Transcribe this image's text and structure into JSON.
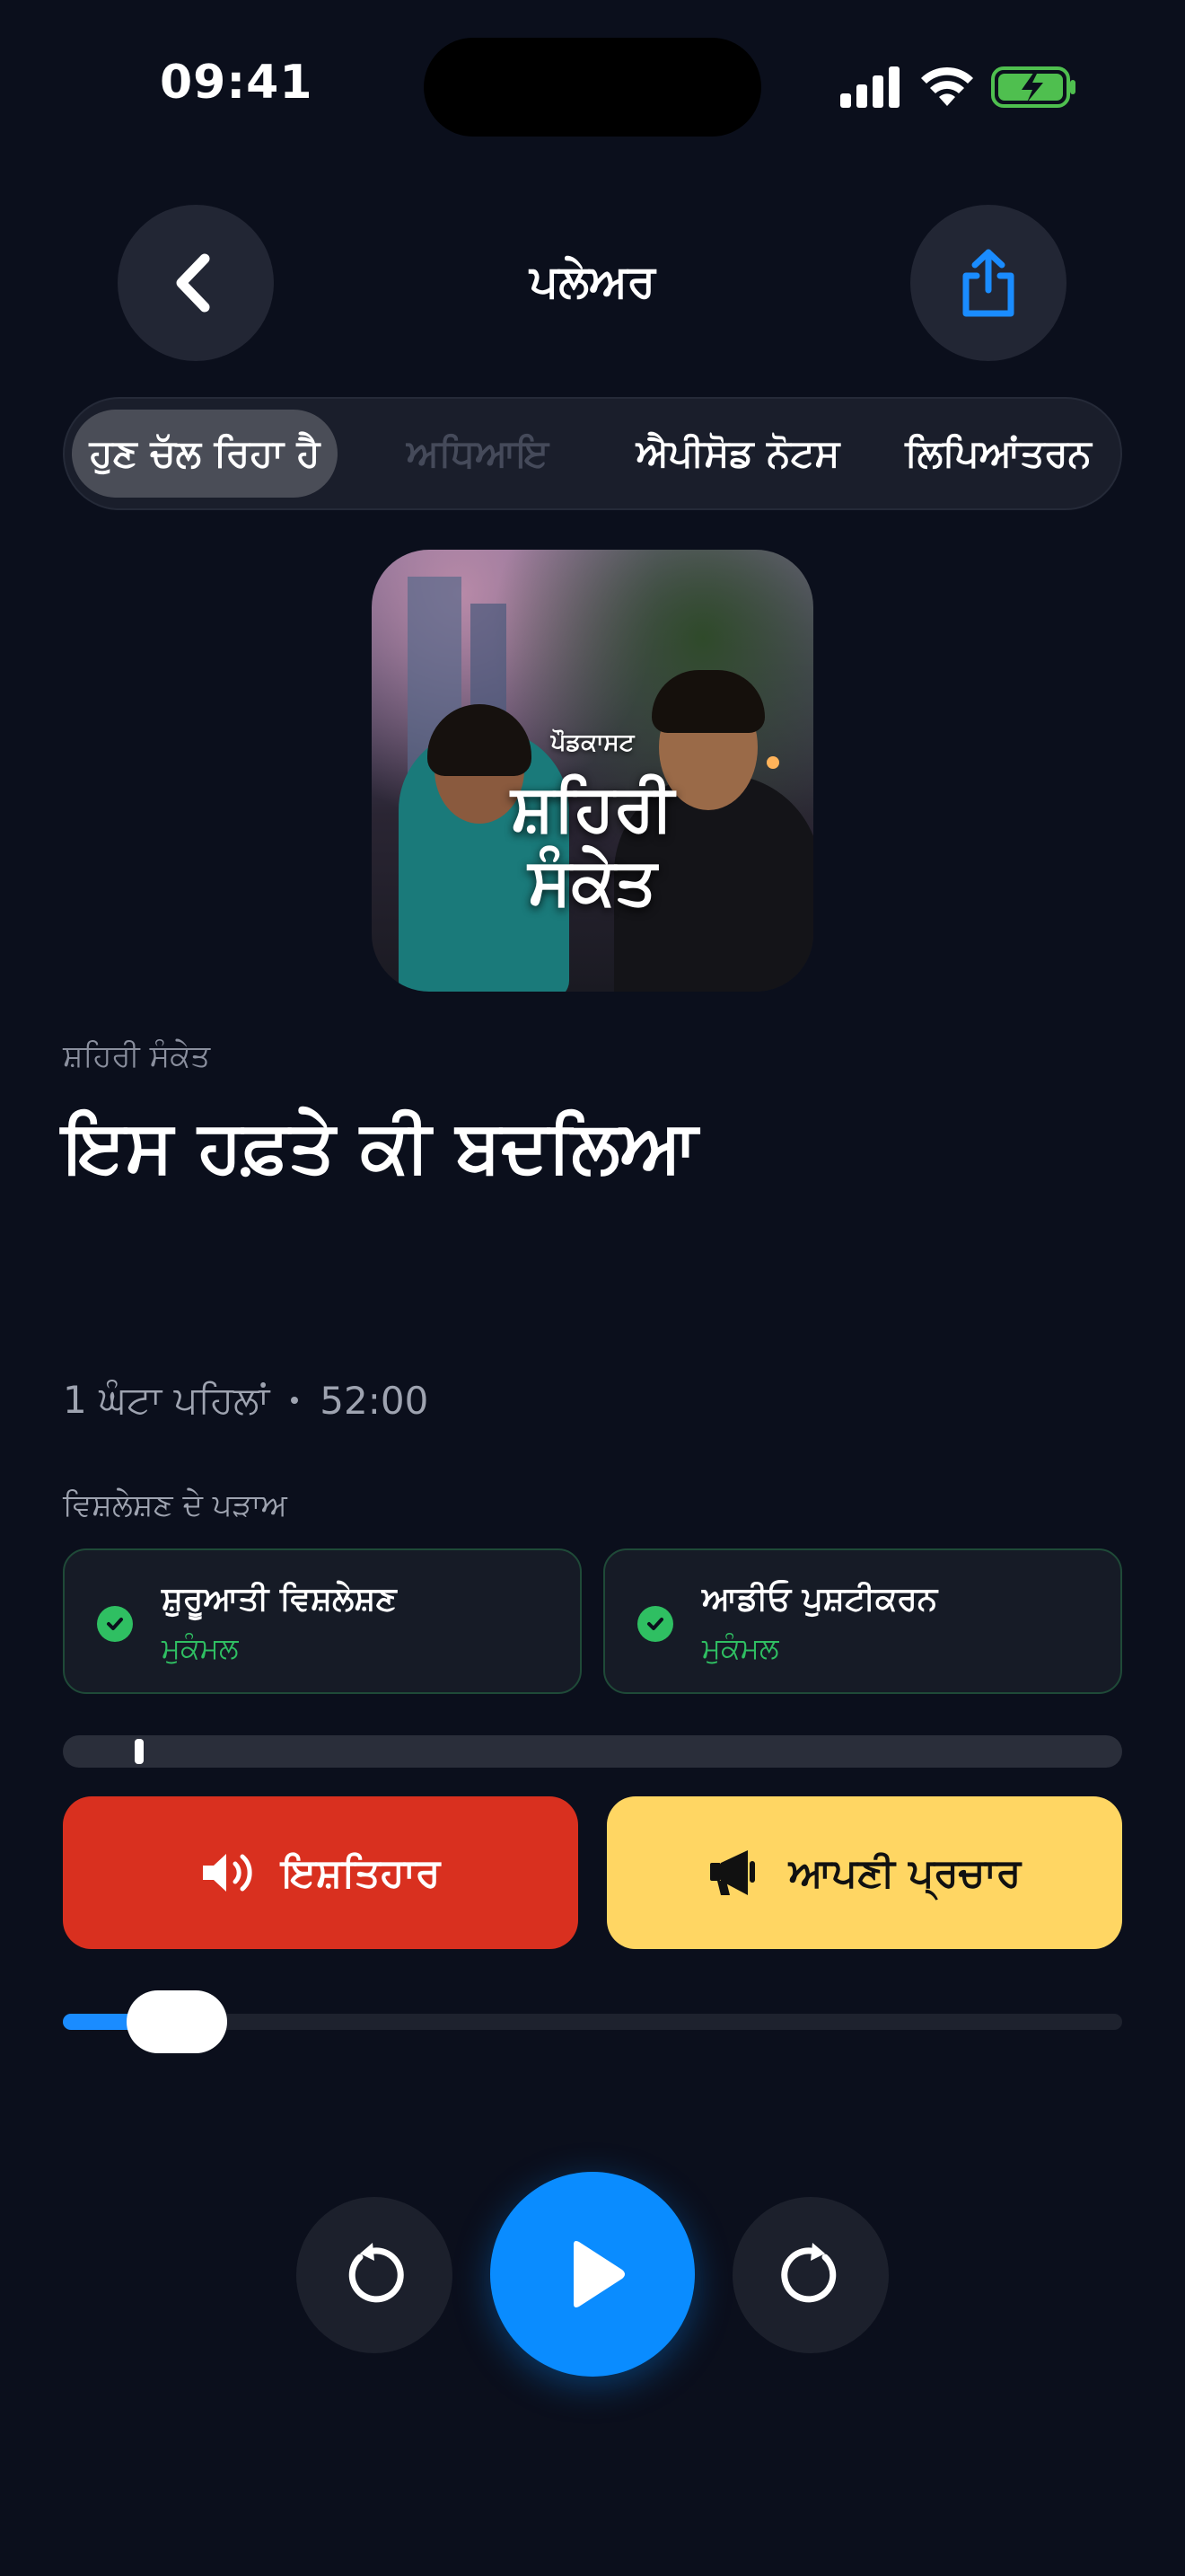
{
  "status_bar": {
    "time": "09:41"
  },
  "header": {
    "title": "ਪਲੇਅਰ"
  },
  "tabs": [
    {
      "label": "ਹੁਣ ਚੱਲ ਰਿਹਾ ਹੈ",
      "active": true
    },
    {
      "label": "ਅਧਿਆਇ",
      "active": false,
      "disabled": true
    },
    {
      "label": "ਐਪੀਸੋਡ ਨੋਟਸ",
      "active": false
    },
    {
      "label": "ਲਿਪਿਆਂਤਰਨ",
      "active": false
    }
  ],
  "cover": {
    "small_text": "ਪੌਡਕਾਸਟ",
    "line1": "ਸ਼ਹਿਰੀ",
    "line2": "ਸੰਕੇਤ"
  },
  "episode": {
    "show_name": "ਸ਼ਹਿਰੀ ਸੰਕੇਤ",
    "title": "ਇਸ ਹਫ਼ਤੇ ਕੀ ਬਦਲਿਆ",
    "published": "1 ਘੰਟਾ ਪਹਿਲਾਂ",
    "duration": "52:00"
  },
  "analysis": {
    "label": "ਵਿਸ਼ਲੇਸ਼ਣ ਦੇ ਪੜਾਅ",
    "stages": [
      {
        "title": "ਸ਼ੁਰੂਆਤੀ ਵਿਸ਼ਲੇਸ਼ਣ",
        "status": "ਮੁਕੰਮਲ"
      },
      {
        "title": "ਆਡੀਓ ਪੁਸ਼ਟੀਕਰਨ",
        "status": "ਮੁਕੰਮਲ"
      }
    ]
  },
  "buttons": {
    "ads": "ਇਸ਼ਤਿਹਾਰ",
    "promo": "ਆਪਣੀ ਪ੍ਰਚਾਰ"
  },
  "playback": {
    "progress_fraction": 0.06,
    "state": "paused"
  },
  "colors": {
    "background": "#0b0f1c",
    "accent_blue": "#0a8cff",
    "ads_red": "#d9301f",
    "promo_yellow": "#ffd663",
    "complete_green": "#2fbf62"
  },
  "icons": [
    "back-chevron-icon",
    "share-icon",
    "speaker-icon",
    "megaphone-icon",
    "rewind-icon",
    "play-icon",
    "forward-icon",
    "check-icon",
    "signal-icon",
    "wifi-icon",
    "battery-charging-icon"
  ]
}
